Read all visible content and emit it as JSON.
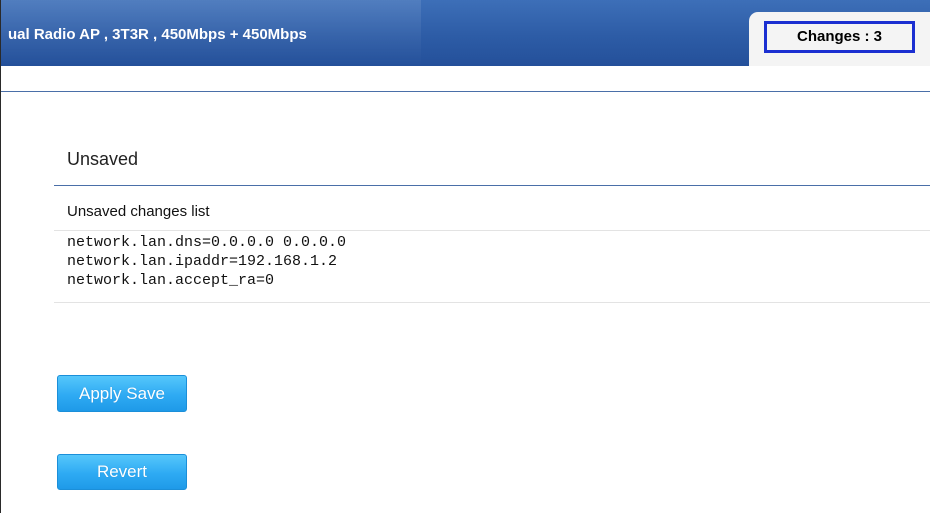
{
  "header": {
    "product_title": "ual Radio AP , 3T3R , 450Mbps + 450Mbps",
    "changes_label": "Changes : 3"
  },
  "section": {
    "title": "Unsaved",
    "list_label": "Unsaved changes list"
  },
  "changes": [
    "network.lan.dns=0.0.0.0 0.0.0.0",
    "network.lan.ipaddr=192.168.1.2",
    "network.lan.accept_ra=0"
  ],
  "buttons": {
    "apply_save": "Apply Save",
    "revert": "Revert"
  },
  "colors": {
    "header_blue": "#2d5ca6",
    "changes_border": "#1b2fd1",
    "button_blue": "#2eaaf3"
  }
}
